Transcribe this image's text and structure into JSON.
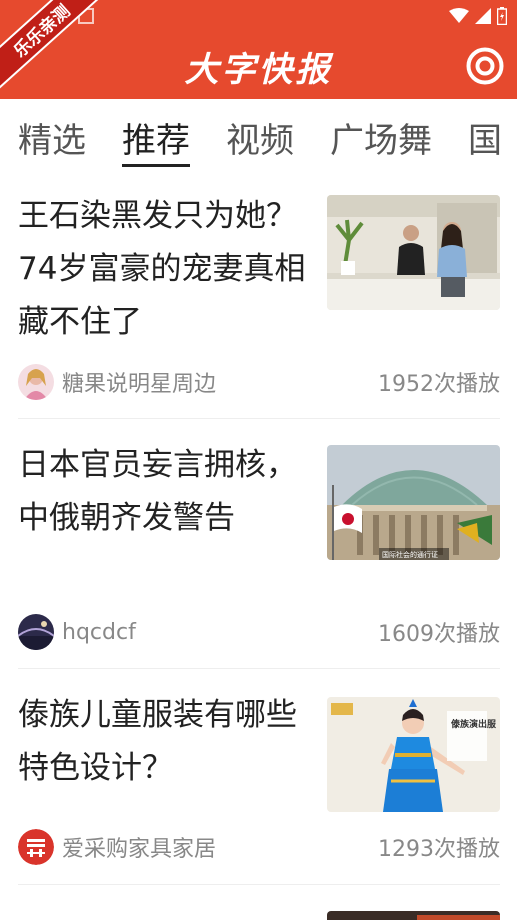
{
  "header": {
    "app_title": "大字快报",
    "badge_text": "乐乐亲测",
    "brand_color": "#e64a2e"
  },
  "tabs": [
    {
      "label": "精选",
      "active": false
    },
    {
      "label": "推荐",
      "active": true
    },
    {
      "label": "视频",
      "active": false
    },
    {
      "label": "广场舞",
      "active": false
    },
    {
      "label": "国",
      "active": false
    }
  ],
  "feed": [
    {
      "title": "王石染黑发只为她？74岁富豪的宠妻真相藏不住了",
      "author": "糖果说明星周边",
      "plays": "1952次播放",
      "thumbnail": "man-and-woman-in-kitchen-photo"
    },
    {
      "title": "日本官员妄言拥核，中俄朝齐发警告",
      "author": "hqcdcf",
      "plays": "1609次播放",
      "thumbnail": "government-building-with-flag-photo",
      "thumb_caption": "国际社会的通行证"
    },
    {
      "title": "傣族儿童服装有哪些特色设计？",
      "author": "爱采购家具家居",
      "plays": "1293次播放",
      "thumbnail": "girl-in-dai-costume-photo",
      "thumb_caption": "傣族演出服"
    }
  ]
}
